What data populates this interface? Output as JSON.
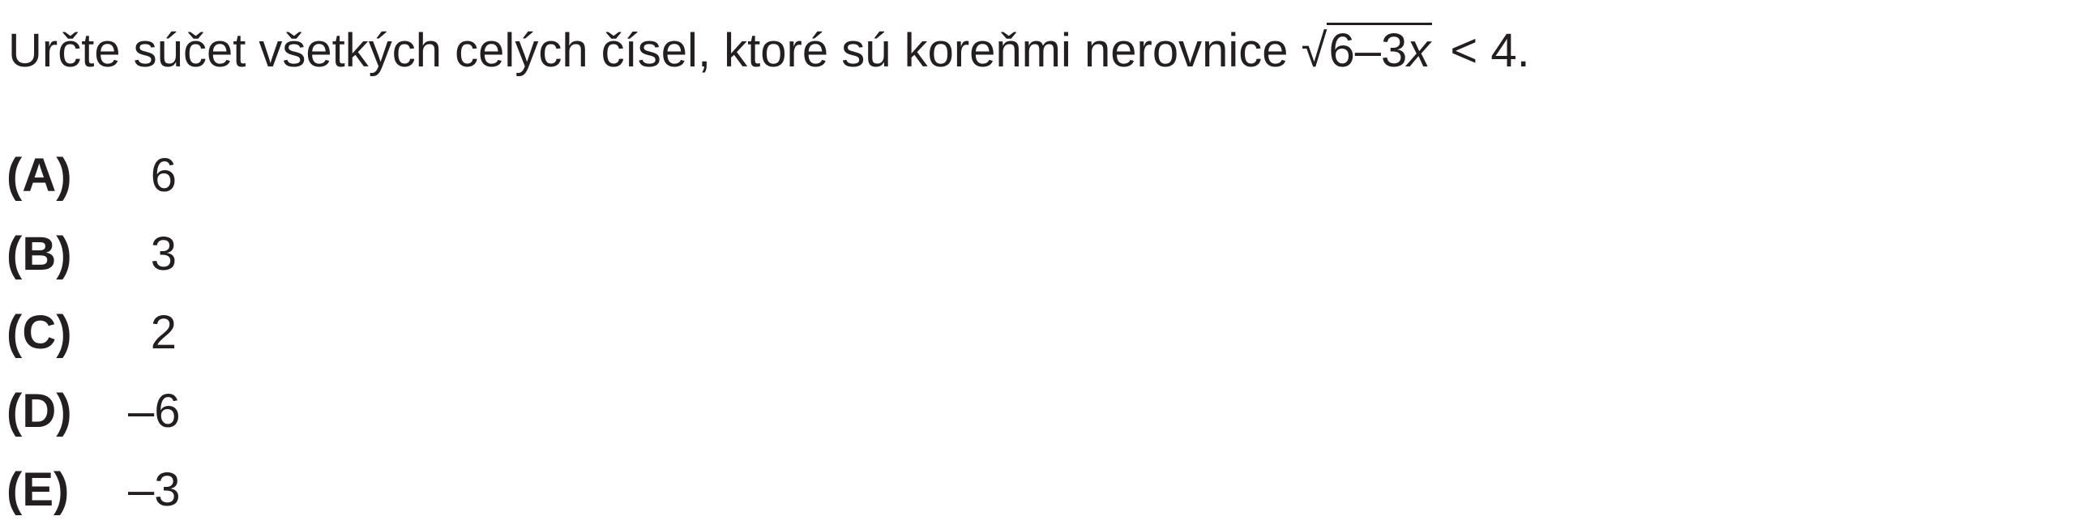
{
  "question": {
    "text": "Určte súčet všetkých celých čísel, ktoré sú koreňmi nerovnice ",
    "radical": "√",
    "radicand_a": "6",
    "radicand_op": "–",
    "radicand_b": "3",
    "radicand_var": "x",
    "relation": "< 4."
  },
  "options": [
    {
      "label": "(A)",
      "value": "6"
    },
    {
      "label": "(B)",
      "value": "3"
    },
    {
      "label": "(C)",
      "value": "2"
    },
    {
      "label": "(D)",
      "value": "–6"
    },
    {
      "label": "(E)",
      "value": "–3"
    }
  ]
}
